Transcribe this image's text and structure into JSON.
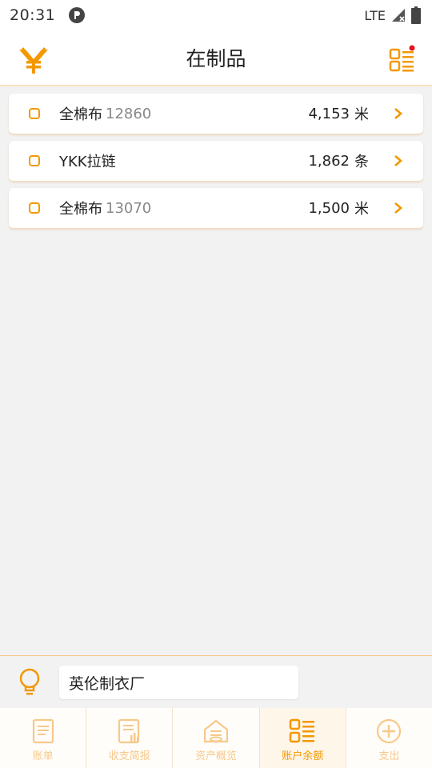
{
  "status_bar": {
    "time": "20:31",
    "network": "LTE"
  },
  "header": {
    "title": "在制品"
  },
  "items": [
    {
      "name": "全棉布",
      "code": "12860",
      "amount": "4,153",
      "unit": "米"
    },
    {
      "name": "YKK拉链",
      "code": "",
      "amount": "1,862",
      "unit": "条"
    },
    {
      "name": "全棉布",
      "code": "13070",
      "amount": "1,500",
      "unit": "米"
    }
  ],
  "footer": {
    "company": "英伦制衣厂"
  },
  "tabs": [
    {
      "label": "账单",
      "icon": "bill-icon",
      "active": false
    },
    {
      "label": "收支简报",
      "icon": "report-icon",
      "active": false
    },
    {
      "label": "资产概览",
      "icon": "assets-icon",
      "active": false
    },
    {
      "label": "账户余额",
      "icon": "balance-icon",
      "active": true
    },
    {
      "label": "支出",
      "icon": "plus-circle-icon",
      "active": false
    }
  ],
  "colors": {
    "accent": "#f39800",
    "accent_light": "#f7c98a",
    "background": "#f2f2f2"
  }
}
